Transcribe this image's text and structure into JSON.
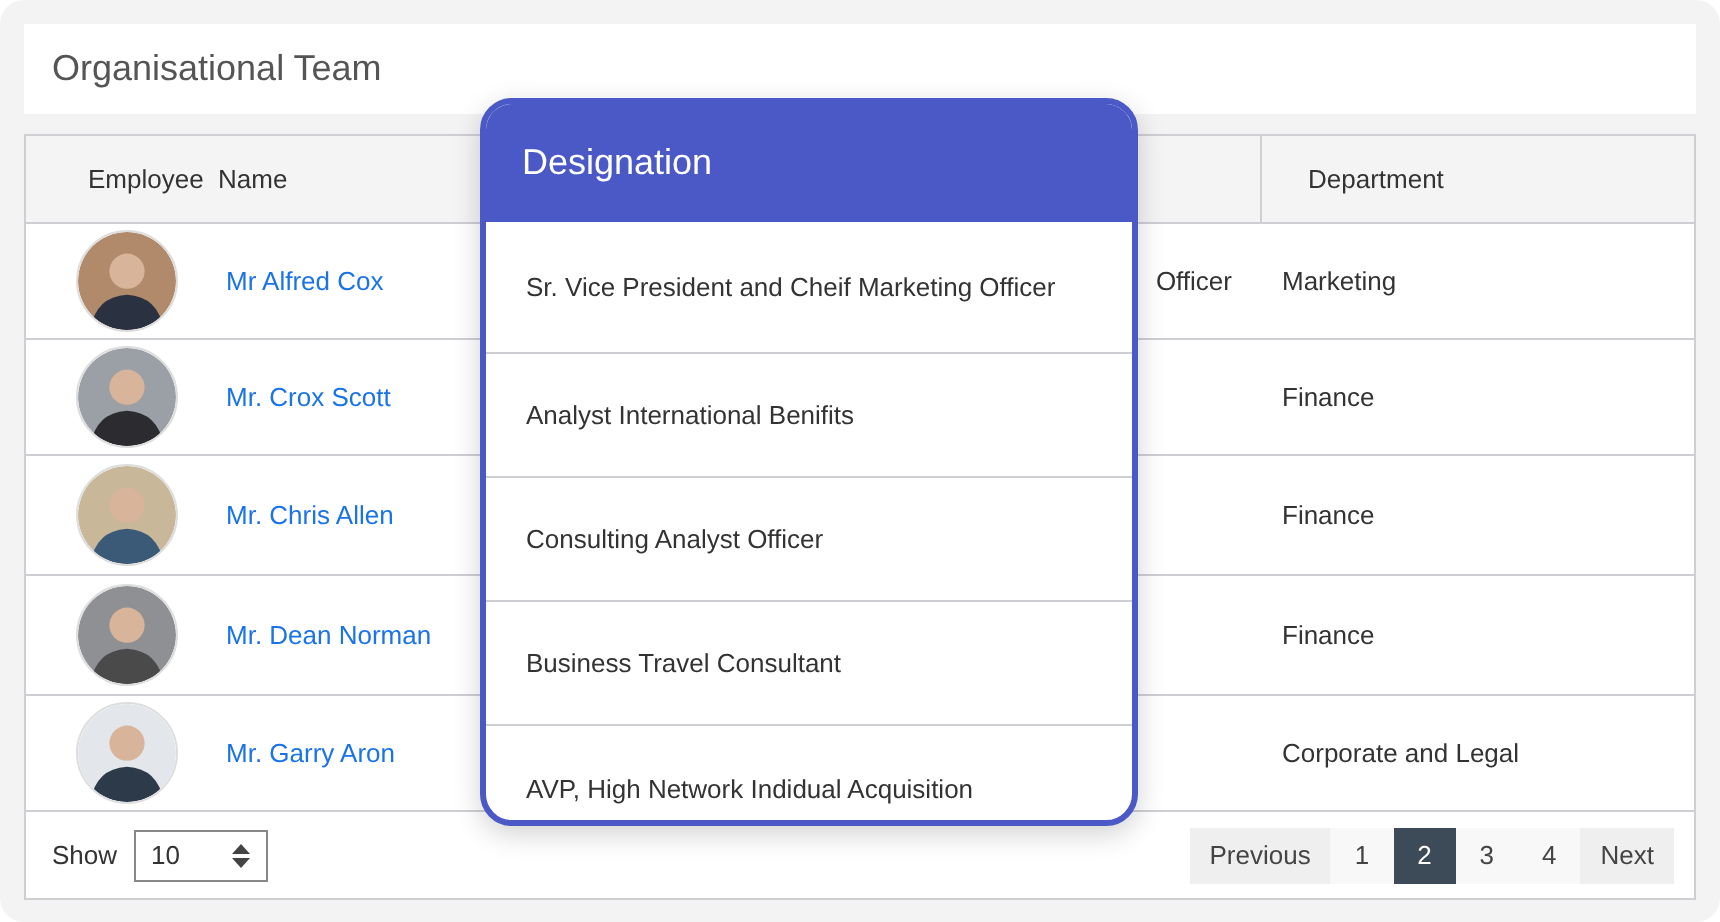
{
  "title": "Organisational Team",
  "table": {
    "columns": [
      {
        "label": "Employee  Name"
      },
      {
        "label": "Department"
      }
    ],
    "rows": [
      {
        "name": "Mr Alfred Cox",
        "column_2": "Officer",
        "department": "Marketing"
      },
      {
        "name": "Mr. Crox Scott",
        "department": "Finance"
      },
      {
        "name": "Mr. Chris Allen",
        "department": "Finance"
      },
      {
        "name": "Mr. Dean Norman",
        "department": "Finance"
      },
      {
        "name": "Mr. Garry Aron",
        "department": "Corporate and Legal"
      }
    ]
  },
  "popup": {
    "title": "Designation",
    "items": [
      "Sr. Vice President and Cheif Marketing Officer",
      "Analyst International Benifits",
      "Consulting Analyst Officer",
      "Business Travel Consultant",
      "AVP, High Network Indidual Acquisition"
    ]
  },
  "footer": {
    "show_label": "Show",
    "page_size": "10",
    "previous": "Previous",
    "next": "Next",
    "pages": [
      {
        "label": "1",
        "selected": false
      },
      {
        "label": "2",
        "selected": true
      },
      {
        "label": "3",
        "selected": false
      },
      {
        "label": "4",
        "selected": false
      }
    ]
  }
}
